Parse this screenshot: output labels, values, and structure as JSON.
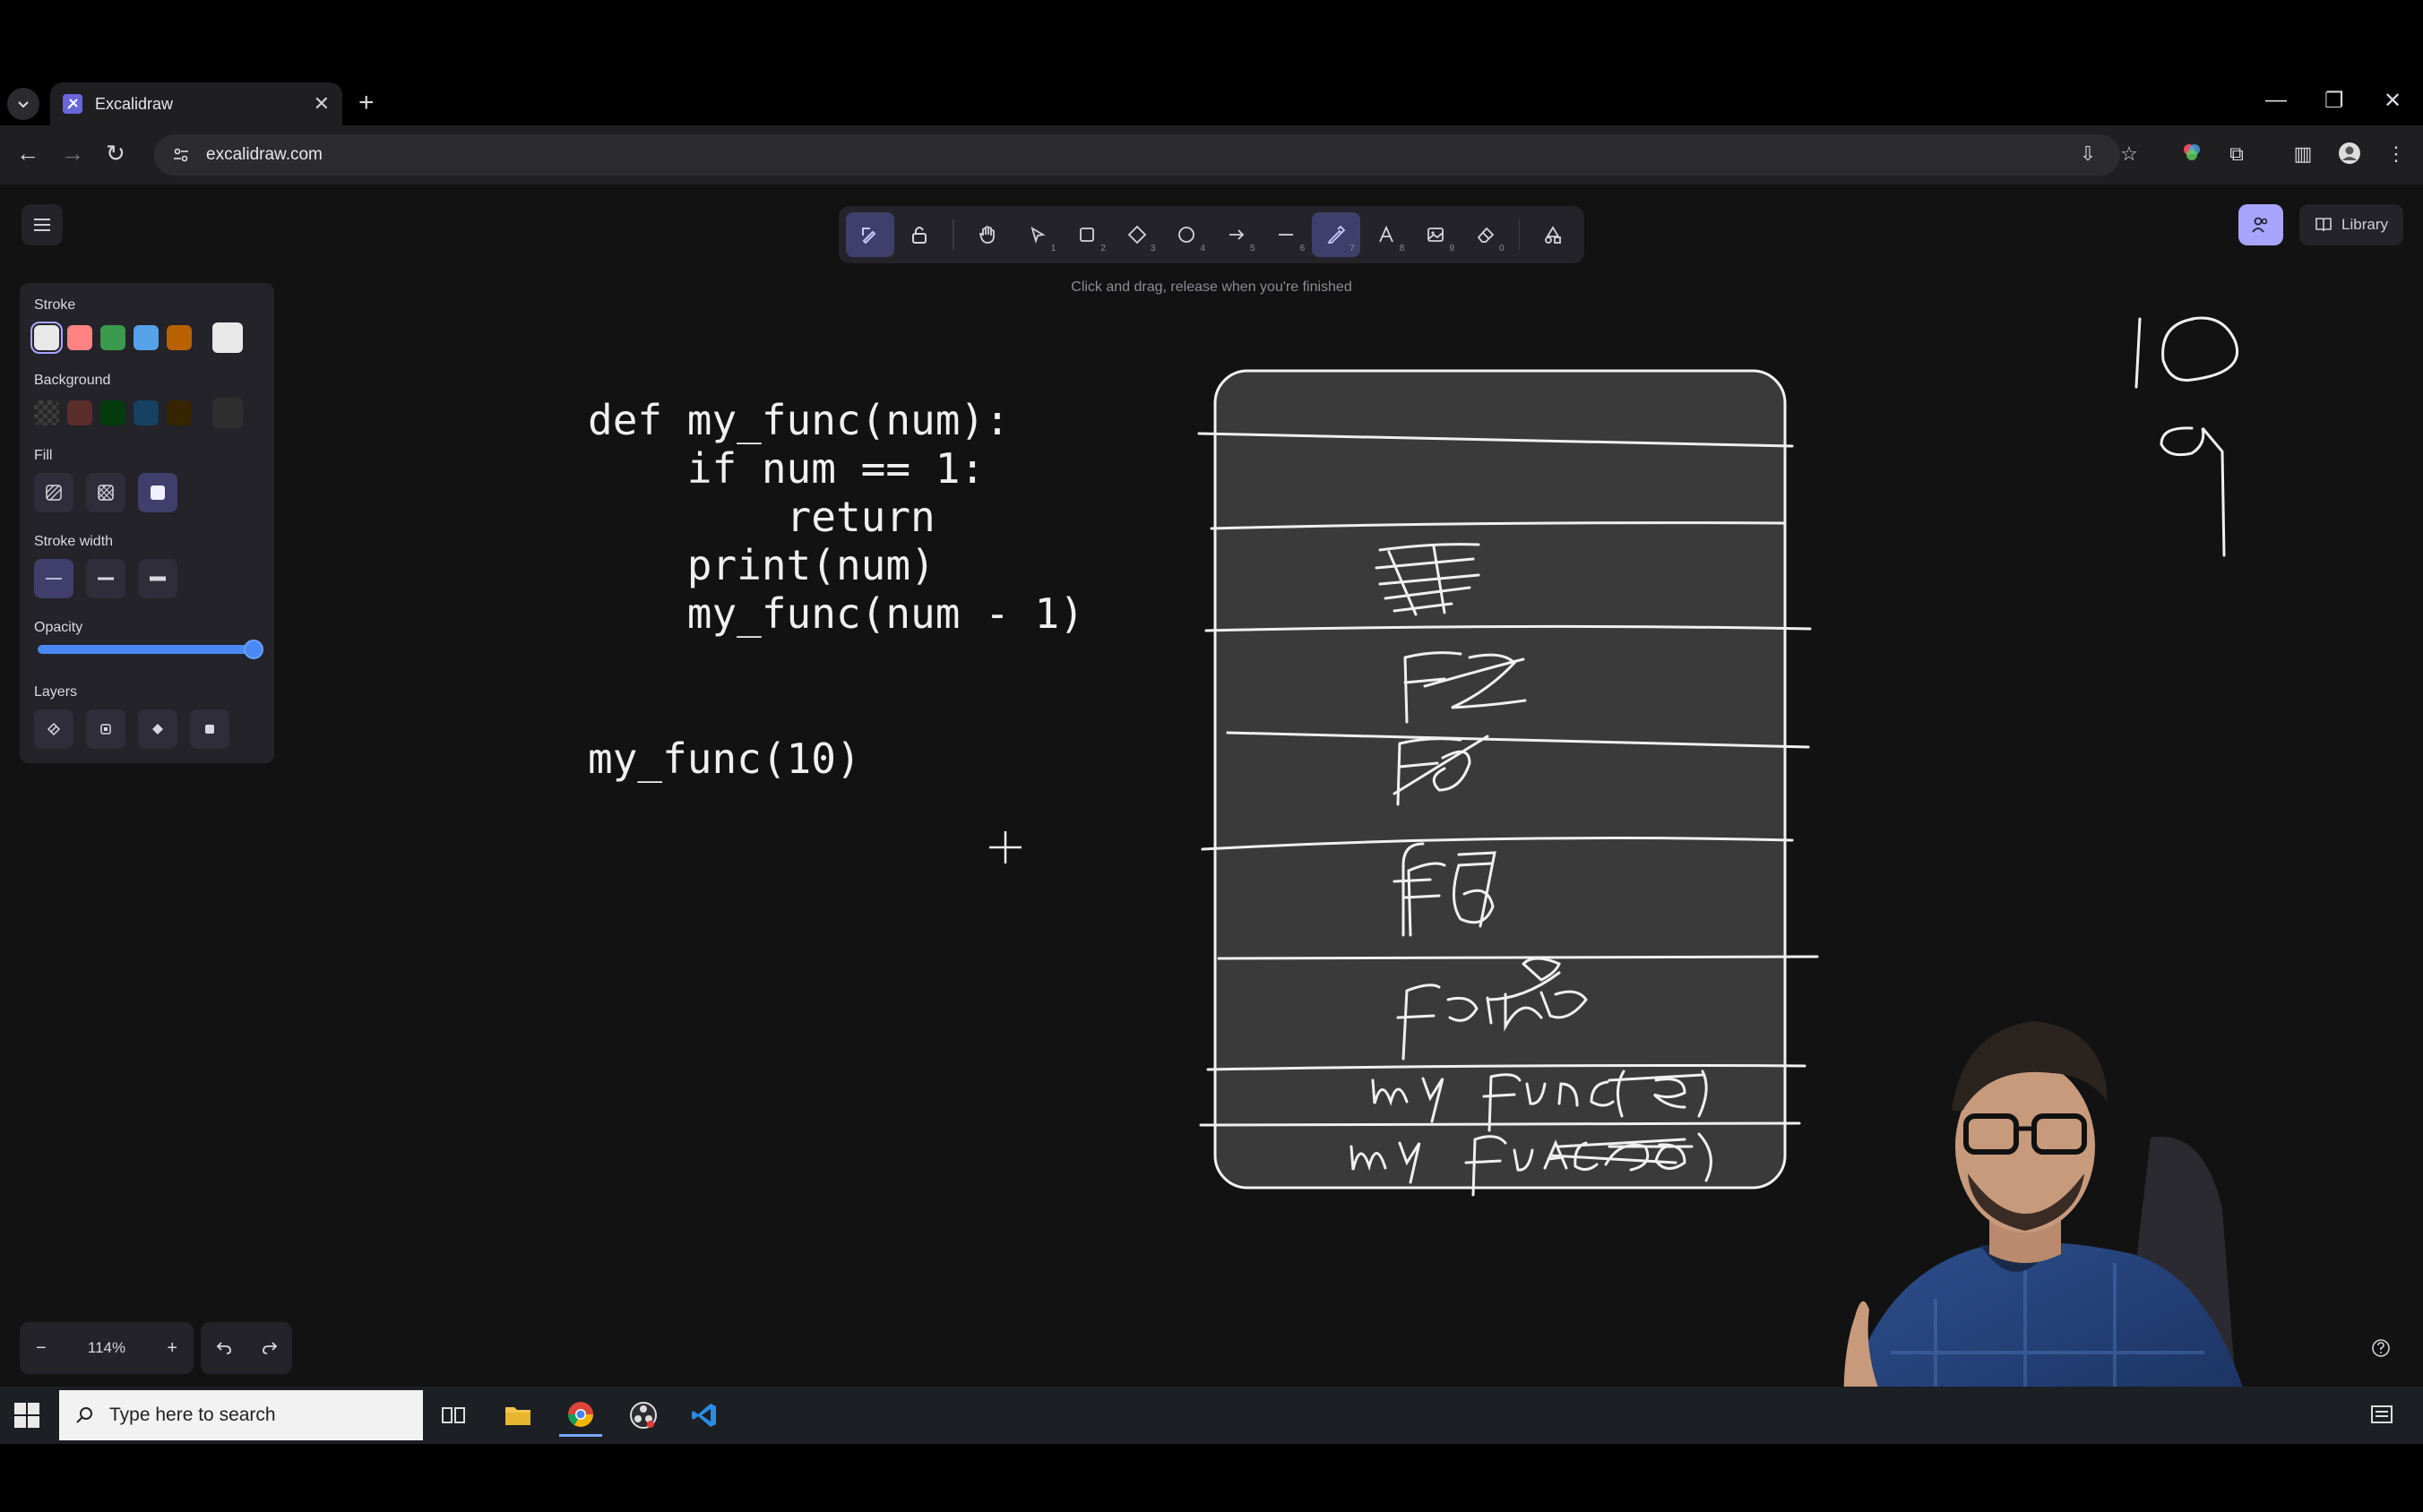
{
  "browser": {
    "tab_title": "Excalidraw",
    "tab_close": "✕",
    "new_tab": "+",
    "url": "excalidraw.com",
    "window_controls": {
      "minimize": "—",
      "restore": "❐",
      "close": "✕"
    }
  },
  "excalidraw": {
    "hint": "Click and drag, release when you're finished",
    "library_label": "Library",
    "tools": [
      {
        "name": "lock-icon",
        "key": ""
      },
      {
        "name": "hand-icon",
        "key": ""
      },
      {
        "name": "selection-icon",
        "key": "1"
      },
      {
        "name": "rectangle-icon",
        "key": "2"
      },
      {
        "name": "diamond-icon",
        "key": "3"
      },
      {
        "name": "ellipse-icon",
        "key": "4"
      },
      {
        "name": "arrow-icon",
        "key": "5"
      },
      {
        "name": "line-icon",
        "key": "6"
      },
      {
        "name": "pen-icon",
        "key": "7"
      },
      {
        "name": "text-icon",
        "key": "8"
      },
      {
        "name": "image-icon",
        "key": "9"
      },
      {
        "name": "eraser-icon",
        "key": "0"
      }
    ],
    "properties": {
      "stroke_label": "Stroke",
      "background_label": "Background",
      "fill_label": "Fill",
      "stroke_width_label": "Stroke width",
      "opacity_label": "Opacity",
      "layers_label": "Layers",
      "stroke_colors": [
        "#e8e8e8",
        "#ff8383",
        "#3a994c",
        "#56a2e8",
        "#b76100",
        "#e8e8e8"
      ],
      "background_colors": [
        "#2e2e2e",
        "#5b2c2c",
        "#043b0c",
        "#154163",
        "#362500",
        "#2e2e2e"
      ],
      "opacity_value": 100
    },
    "zoom": {
      "value": "114%",
      "minus": "−",
      "plus": "+"
    }
  },
  "canvas": {
    "code_lines": [
      "def my_func(num):",
      "    if num == 1:",
      "        return",
      "    print(num)",
      "    my_func(num - 1)",
      "my_func(10)"
    ],
    "stack_labels": [
      "f6",
      "f7",
      "func8",
      "my func(9)",
      "my func(10)"
    ],
    "side_numbers": [
      "10",
      "9"
    ]
  },
  "taskbar": {
    "search_placeholder": "Type here to search"
  }
}
